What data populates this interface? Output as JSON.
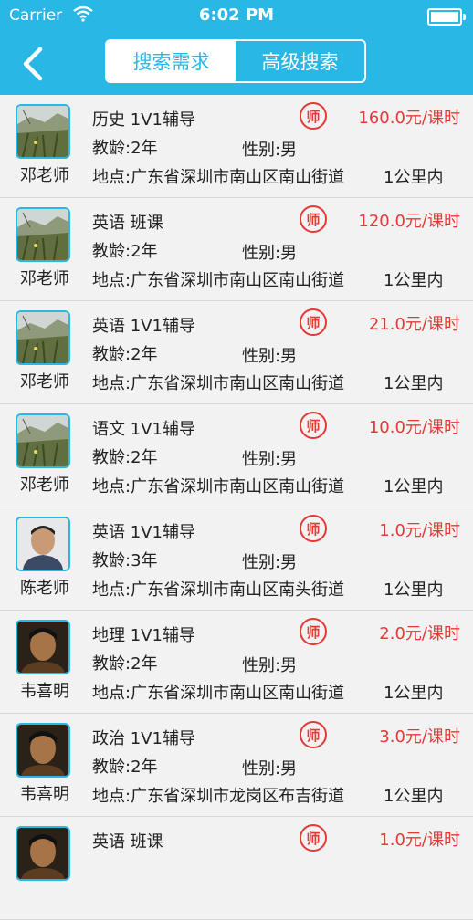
{
  "status": {
    "carrier": "Carrier",
    "time": "6:02 PM"
  },
  "nav": {
    "back_icon": "chevron-left-icon",
    "segments": [
      {
        "label": "搜索需求",
        "active": true
      },
      {
        "label": "高级搜索",
        "active": false
      }
    ]
  },
  "badge_text": "师",
  "colors": {
    "accent": "#29b8e6",
    "price": "#e53935",
    "background": "#f2f2f2"
  },
  "items": [
    {
      "name": "邓老师",
      "course": "历史 1V1辅导",
      "price": "160.0元/课时",
      "experience": "教龄:2年",
      "gender": "性别:男",
      "address": "地点:广东省深圳市南山区南山街道",
      "distance": "1公里内",
      "avatar": "landscape"
    },
    {
      "name": "邓老师",
      "course": "英语 班课",
      "price": "120.0元/课时",
      "experience": "教龄:2年",
      "gender": "性别:男",
      "address": "地点:广东省深圳市南山区南山街道",
      "distance": "1公里内",
      "avatar": "landscape"
    },
    {
      "name": "邓老师",
      "course": "英语 1V1辅导",
      "price": "21.0元/课时",
      "experience": "教龄:2年",
      "gender": "性别:男",
      "address": "地点:广东省深圳市南山区南山街道",
      "distance": "1公里内",
      "avatar": "landscape"
    },
    {
      "name": "邓老师",
      "course": "语文 1V1辅导",
      "price": "10.0元/课时",
      "experience": "教龄:2年",
      "gender": "性别:男",
      "address": "地点:广东省深圳市南山区南山街道",
      "distance": "1公里内",
      "avatar": "landscape"
    },
    {
      "name": "陈老师",
      "course": "英语 1V1辅导",
      "price": "1.0元/课时",
      "experience": "教龄:3年",
      "gender": "性别:男",
      "address": "地点:广东省深圳市南山区南头街道",
      "distance": "1公里内",
      "avatar": "portrait-light"
    },
    {
      "name": "韦喜明",
      "course": "地理 1V1辅导",
      "price": "2.0元/课时",
      "experience": "教龄:2年",
      "gender": "性别:男",
      "address": "地点:广东省深圳市南山区南山街道",
      "distance": "1公里内",
      "avatar": "portrait-dark"
    },
    {
      "name": "韦喜明",
      "course": "政治 1V1辅导",
      "price": "3.0元/课时",
      "experience": "教龄:2年",
      "gender": "性别:男",
      "address": "地点:广东省深圳市龙岗区布吉街道",
      "distance": "1公里内",
      "avatar": "portrait-dark"
    },
    {
      "name": "",
      "course": "英语 班课",
      "price": "1.0元/课时",
      "experience": "",
      "gender": "",
      "address": "",
      "distance": "",
      "avatar": "portrait-dark"
    }
  ]
}
